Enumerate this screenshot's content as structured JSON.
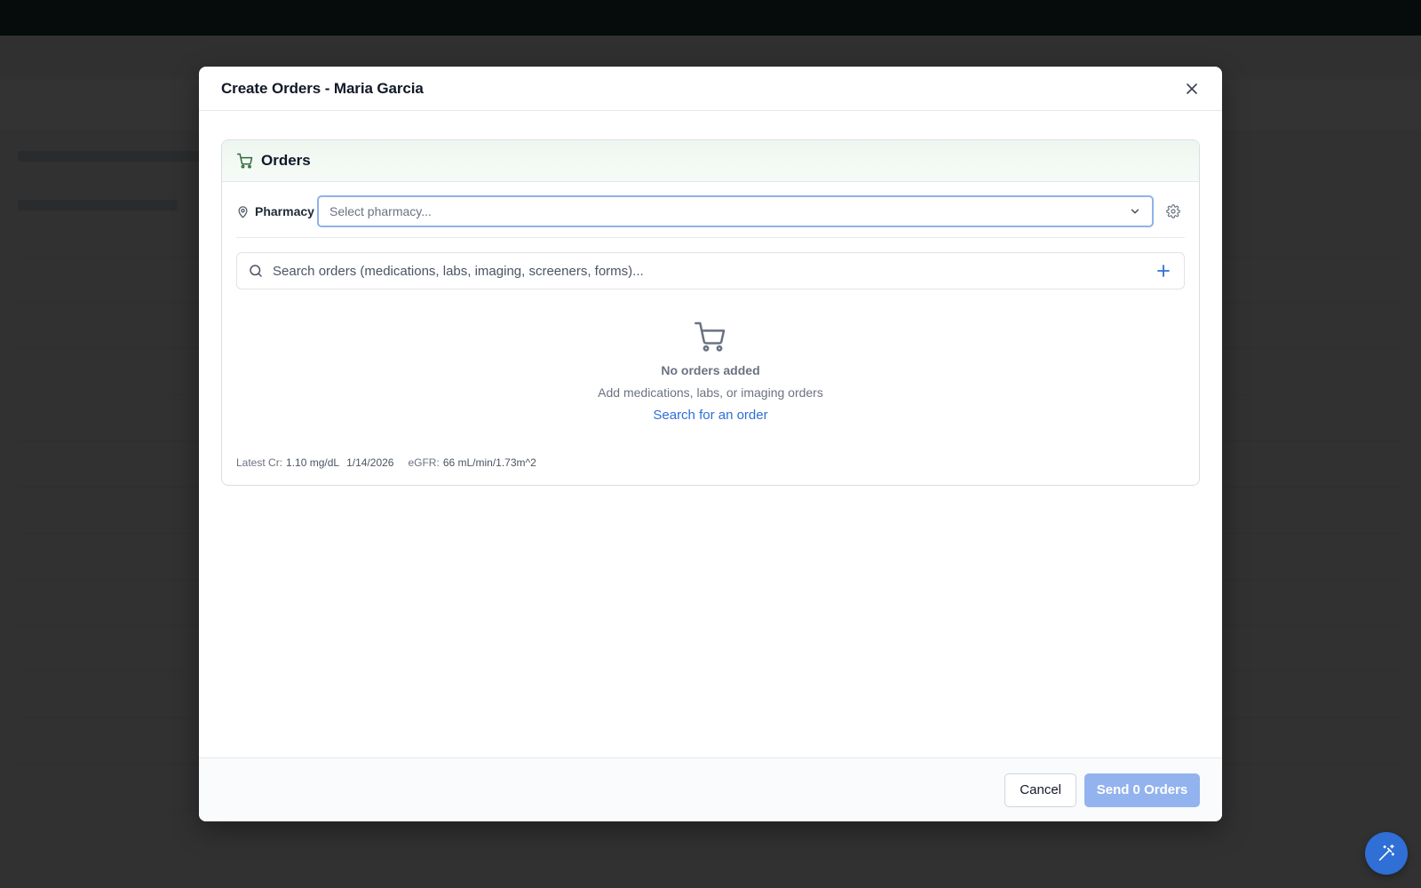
{
  "modal": {
    "title": "Create Orders - Maria Garcia",
    "close_icon": "close-icon"
  },
  "orders_card": {
    "title": "Orders",
    "icon": "shopping-cart-icon",
    "pharmacy": {
      "label": "Pharmacy",
      "icon": "map-pin-icon",
      "placeholder": "Select pharmacy...",
      "dropdown_icon": "chevron-down-icon",
      "settings_icon": "gear-icon"
    },
    "search": {
      "placeholder": "Search orders (medications, labs, imaging, screeners, forms)...",
      "icon": "search-icon",
      "add_icon": "plus-icon"
    },
    "empty_state": {
      "icon": "shopping-cart-icon",
      "title": "No orders added",
      "subtitle": "Add medications, labs, or imaging orders",
      "link": "Search for an order"
    },
    "labs": {
      "cr_label": "Latest Cr:",
      "cr_value": "1.10 mg/dL",
      "cr_date": "1/14/2026",
      "egfr_label": "eGFR:",
      "egfr_value": "66 mL/min/1.73m^2"
    }
  },
  "footer": {
    "cancel_label": "Cancel",
    "send_label": "Send 0 Orders"
  },
  "fab": {
    "icon": "magic-wand-icon"
  },
  "colors": {
    "accent": "#2f6fd6",
    "send_disabled": "#93b3ee",
    "pharmacy_border": "#8fb2e8",
    "cart_green": "#2f6b3e"
  }
}
